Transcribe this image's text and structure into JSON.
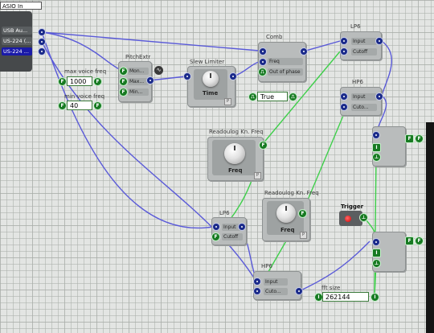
{
  "asio": {
    "title": "ASIO In",
    "outputs": [
      "USB Au...",
      "US-224 (...",
      "US-224 ..."
    ]
  },
  "voice": {
    "max_label": "max voice freq",
    "max_value": "1000",
    "min_label": "min voice freq",
    "min_value": "40"
  },
  "pitch": {
    "title": "PitchExtr",
    "ports": [
      "Mon...",
      "Max...",
      "Min..."
    ]
  },
  "slew": {
    "title": "Slew Limiter",
    "knob_label": "Time"
  },
  "comb": {
    "title": "Comb",
    "ports": [
      "Freq",
      "Out of phase"
    ],
    "toggle_value": "True"
  },
  "lp6_top": {
    "title": "LP6",
    "ports": [
      "Input",
      "Cutoff"
    ]
  },
  "hp6_top": {
    "title": "HP6",
    "ports": [
      "Input",
      "Cuto..."
    ]
  },
  "readout1": {
    "title": "Readoulog Kn. Freq",
    "knob_label": "Freq"
  },
  "readout2": {
    "title": "Readoulog Kn. Freq",
    "knob_label": "Freq"
  },
  "lp6_mid": {
    "title": "LP6",
    "ports": [
      "Input",
      "Cutoff"
    ]
  },
  "hp6_bot": {
    "title": "HP6",
    "ports": [
      "Input",
      "Cuto..."
    ]
  },
  "trigger": {
    "title": "Trigger"
  },
  "fft": {
    "title": "fft size",
    "value": "262144"
  },
  "port_glyphs": {
    "float": "F",
    "integer": "I",
    "bool": "⊥"
  },
  "colors": {
    "wire_blue": "#5a5ad8",
    "wire_green": "#3ecf4a",
    "port_blue": "#1a2a8a",
    "port_green": "#177a22",
    "module_bg": "#b9bcbc",
    "trigger_red": "#d40000"
  }
}
